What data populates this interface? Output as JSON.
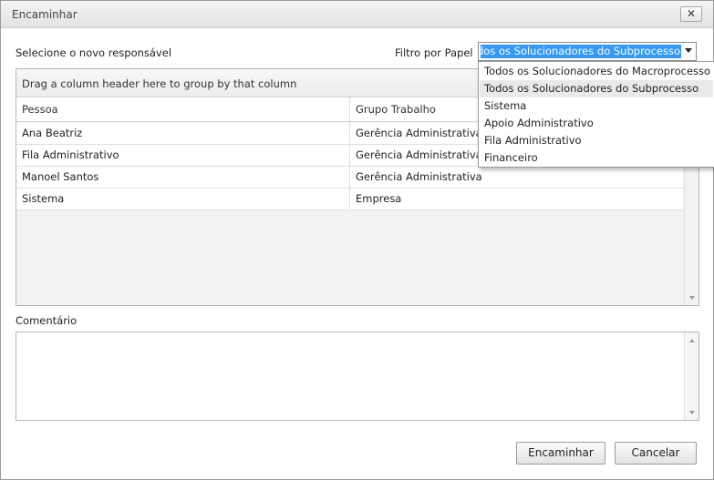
{
  "window": {
    "title": "Encaminhar",
    "close_glyph": "✕",
    "close_icon": "close-icon"
  },
  "labels": {
    "select_responsible": "Selecione o novo responsável",
    "filter_role": "Filtro por Papel",
    "comment": "Comentário"
  },
  "filter": {
    "selected_value": "Todos os Solucionadores do Subprocesso",
    "options": [
      "Todos os Solucionadores do Macroprocesso",
      "Todos os Solucionadores do Subprocesso",
      "Sistema",
      "Apoio Administrativo",
      "Fila Administrativo",
      "Financeiro"
    ],
    "hovered_index": 1
  },
  "grid": {
    "group_hint": "Drag a column header here to group by that column",
    "columns": [
      "Pessoa",
      "Grupo Trabalho"
    ],
    "rows": [
      [
        "Ana Beatriz",
        "Gerência Administrativa"
      ],
      [
        "Fila Administrativo",
        "Gerência Administrativa"
      ],
      [
        "Manoel Santos",
        "Gerência Administrativa"
      ],
      [
        "Sistema",
        "Empresa"
      ]
    ]
  },
  "comment": {
    "value": ""
  },
  "buttons": {
    "forward": "Encaminhar",
    "cancel": "Cancelar"
  }
}
